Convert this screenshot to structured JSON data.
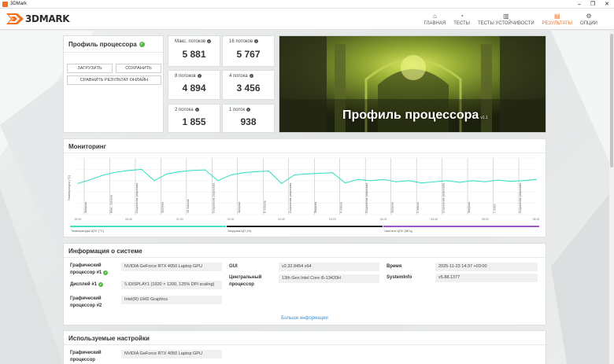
{
  "window": {
    "title": "3DMark",
    "controls": [
      "–",
      "❐",
      "✕"
    ]
  },
  "app": {
    "logo_text": "3DMARK",
    "brand_color": "#f36f21"
  },
  "nav": [
    {
      "label": "ГЛАВНАЯ",
      "icon": "home-icon",
      "glyph": "⌂",
      "active": false
    },
    {
      "label": "ТЕСТЫ",
      "icon": "gauge-icon",
      "glyph": "◔",
      "active": false
    },
    {
      "label": "ТЕСТЫ УСТОЙЧИВОСТИ",
      "icon": "bars-chart-icon",
      "glyph": "▥",
      "active": false
    },
    {
      "label": "РЕЗУЛЬТАТЫ",
      "icon": "results-chart-icon",
      "glyph": "▤",
      "active": true
    },
    {
      "label": "ОПЦИИ",
      "icon": "gear-icon",
      "glyph": "⚙",
      "active": false
    }
  ],
  "profile": {
    "title": "Профиль процессора",
    "load_btn": "ЗАГРУЗИТЬ",
    "save_btn": "СОХРАНИТЬ",
    "compare_btn": "СРАВНИТЬ РЕЗУЛЬТАТ ОНЛАЙН"
  },
  "scores": [
    {
      "label": "Макс. потоков",
      "value": "5 881"
    },
    {
      "label": "16 потоков",
      "value": "5 767"
    },
    {
      "label": "8 потоков",
      "value": "4 894"
    },
    {
      "label": "4 потока",
      "value": "3 456"
    },
    {
      "label": "2 потока",
      "value": "1 855"
    },
    {
      "label": "1 поток",
      "value": "938"
    }
  ],
  "hero": {
    "title": "Профиль процессора",
    "version": "v1.1"
  },
  "monitoring": {
    "title": "Мониторинг",
    "y_label": "Температура (°C)",
    "legend": [
      {
        "label": "Температура ЦПУ (°C)",
        "color": "#3fe0c5"
      },
      {
        "label": "Загрузка ЦП (%)",
        "color": "#222222"
      },
      {
        "label": "Частота ЦПУ (МГц)",
        "color": "#9b59d0"
      }
    ],
    "x_ticks": [
      "00:00",
      "00:40",
      "01:20",
      "02:00",
      "02:40",
      "03:20",
      "04:00",
      "04:40",
      "05:20",
      "06:00"
    ],
    "y_ticks": [
      "100",
      "80",
      "60",
      "40",
      "20",
      "0"
    ],
    "markers": [
      "Загрузка",
      "Макс. потоков",
      "Сохранение результата",
      "Загрузка",
      "16 потоков",
      "Сохранение результата",
      "Загрузка",
      "8 потоков",
      "Сохранение результата",
      "Загрузка",
      "4 потока",
      "Сохранение результата",
      "Загрузка",
      "2 потока",
      "Сохранение результата",
      "Загрузка",
      "1 поток",
      "Сохранение результата"
    ]
  },
  "chart_data": {
    "type": "line",
    "x": [
      0,
      10,
      20,
      30,
      40,
      50,
      60,
      70,
      80,
      90,
      100,
      110,
      120,
      130,
      140,
      150,
      160,
      170,
      180,
      190,
      200,
      210,
      220,
      230,
      240,
      250,
      260,
      270,
      280,
      290,
      300,
      310,
      320,
      330,
      340,
      350,
      360
    ],
    "series": [
      {
        "name": "Температура ЦПУ (°C)",
        "values": [
          55,
          62,
          70,
          75,
          78,
          80,
          60,
          72,
          76,
          78,
          79,
          60,
          70,
          74,
          76,
          77,
          55,
          70,
          72,
          73,
          74,
          56,
          62,
          60,
          62,
          58,
          60,
          56,
          58,
          60,
          57,
          60,
          58,
          61,
          59,
          60,
          62
        ]
      }
    ],
    "xlabel": "",
    "ylabel": "Температура (°C)",
    "ylim": [
      0,
      100
    ]
  },
  "sysinfo": {
    "title": "Информация о системе",
    "gpu1_label": "Графический процессор #1",
    "gpu1_value": "NVIDIA GeForce RTX 4050 Laptop GPU",
    "display_label": "Дисплей #1",
    "display_value": "\\\\.\\DISPLAY1 (1920 × 1200, 125% DPI scaling)",
    "gpu2_label": "Графический процессор #2",
    "gpu2_value": "Intel(R) UHD Graphics",
    "gui_label": "GUI",
    "gui_value": "v2.32.8454 s64",
    "cpu_label": "Центральный процессор",
    "cpu_value": "13th Gen Intel Core i5-13420H",
    "time_label": "Время",
    "time_value": "2025-11-23 14:37 +03:00",
    "sysinfo_label": "SystemInfo",
    "sysinfo_value": "v5.88.1377",
    "more_link": "Больше информации"
  },
  "settings": {
    "title": "Используемые настройки",
    "gpu_label": "Графический процессор",
    "gpu_value": "NVIDIA GeForce RTX 4050 Laptop GPU"
  }
}
